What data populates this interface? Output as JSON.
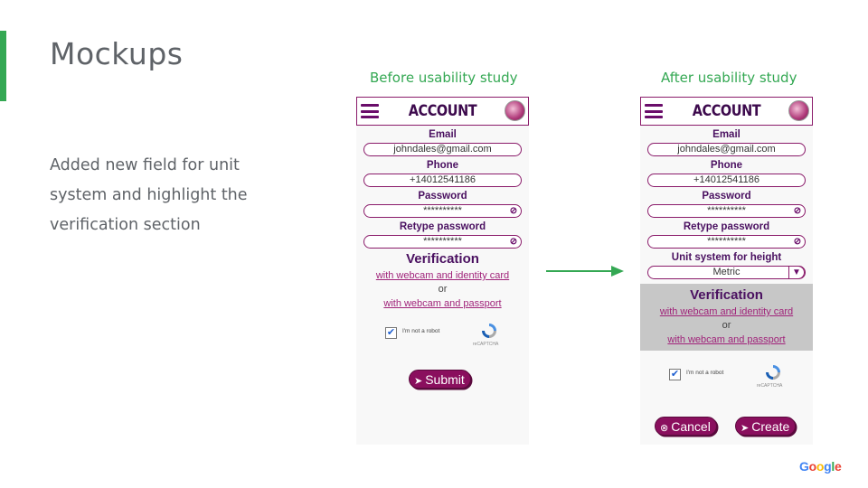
{
  "slide": {
    "title": "Mockups",
    "description": "Added new field for unit system and highlight the verification section",
    "caption_before": "Before usability study",
    "caption_after": "After usability study",
    "accent_color": "#34a853",
    "footer_logo": "Google"
  },
  "before": {
    "app_title": "ACCOUNT",
    "email_label": "Email",
    "email_value": "johndales@gmail.com",
    "phone_label": "Phone",
    "phone_value": "+14012541186",
    "password_label": "Password",
    "password_value": "**********",
    "retype_label": "Retype password",
    "retype_value": "**********",
    "verification_title": "Verification",
    "link_identity": "with webcam and identity card",
    "or_text": "or",
    "link_passport": "with webcam and passport",
    "captcha_label": "I'm not a robot",
    "captcha_brand": "reCAPTCHA",
    "submit_label": "Submit"
  },
  "after": {
    "app_title": "ACCOUNT",
    "email_label": "Email",
    "email_value": "johndales@gmail.com",
    "phone_label": "Phone",
    "phone_value": "+14012541186",
    "password_label": "Password",
    "password_value": "**********",
    "retype_label": "Retype password",
    "retype_value": "**********",
    "unit_label": "Unit system for height",
    "unit_value": "Metric",
    "verification_title": "Verification",
    "link_identity": "with webcam and identity card",
    "or_text": "or",
    "link_passport": "with webcam and passport",
    "captcha_label": "I'm not a robot",
    "captcha_brand": "reCAPTCHA",
    "cancel_label": "Cancel",
    "create_label": "Create"
  },
  "icons": {
    "menu": "hamburger-icon",
    "avatar": "avatar-image",
    "password_toggle": "eye-slash-icon",
    "dropdown": "triangle-down-icon",
    "submit": "arrow-right-icon",
    "cancel": "x-circle-icon",
    "transition": "green-arrow-right"
  },
  "colors": {
    "brand_purple": "#8a0f5e",
    "title_purple": "#3d0a4d",
    "verification_highlight": "#c7c7c7",
    "link": "#a0237a"
  }
}
